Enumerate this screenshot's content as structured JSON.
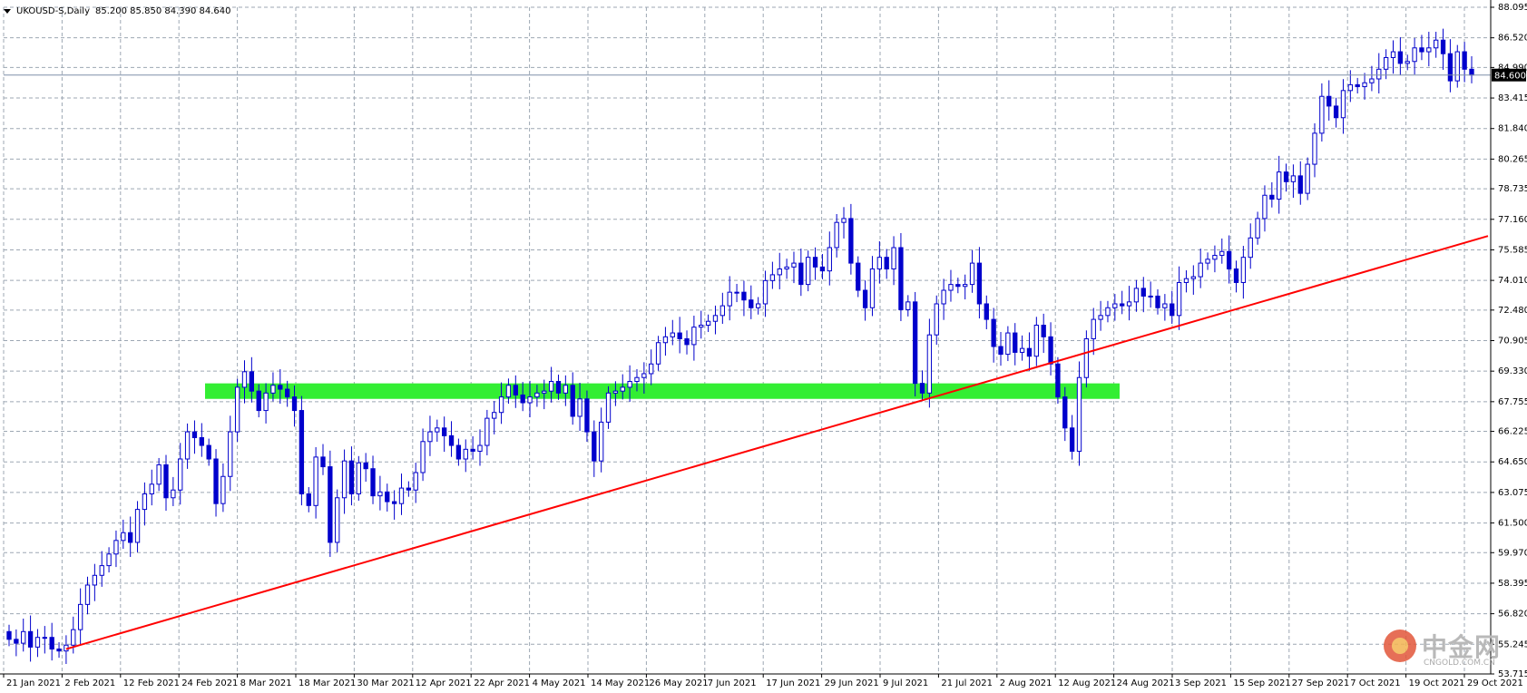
{
  "header": {
    "symbol": "UKOUSD-S,Daily",
    "ohlc": "85.200 85.850 84.390 84.640"
  },
  "watermark": {
    "brand": "中金网",
    "site": "CNGOLD.COM.CN"
  },
  "colors": {
    "bull_candle": "#ffffff",
    "bear_candle": "#0000cc",
    "candle_outline": "#0000cc",
    "trendline": "#ff0000",
    "support_zone": "#33ee33",
    "grid": "#9da7b3",
    "price_line": "#7f8fa8",
    "price_tag_bg": "#000000",
    "price_tag_fg": "#ffffff"
  },
  "chart_data": {
    "type": "candlestick",
    "y_ticks": [
      "88.095",
      "86.520",
      "84.990",
      "83.415",
      "81.840",
      "80.265",
      "78.735",
      "77.160",
      "75.585",
      "74.010",
      "72.480",
      "70.905",
      "69.330",
      "67.755",
      "66.225",
      "64.650",
      "63.075",
      "61.500",
      "59.970",
      "58.395",
      "56.820",
      "55.245",
      "53.715"
    ],
    "ylim": [
      53.715,
      88.095
    ],
    "x_ticks": [
      "21 Jan 2021",
      "2 Feb 2021",
      "12 Feb 2021",
      "24 Feb 2021",
      "8 Mar 2021",
      "18 Mar 2021",
      "30 Mar 2021",
      "12 Apr 2021",
      "22 Apr 2021",
      "4 May 2021",
      "14 May 2021",
      "26 May 2021",
      "7 Jun 2021",
      "17 Jun 2021",
      "29 Jun 2021",
      "9 Jul 2021",
      "21 Jul 2021",
      "2 Aug 2021",
      "12 Aug 2021",
      "24 Aug 2021",
      "3 Sep 2021",
      "15 Sep 2021",
      "27 Sep 2021",
      "7 Oct 2021",
      "19 Oct 2021",
      "29 Oct 2021"
    ],
    "closes": [
      55.5,
      55.3,
      55.9,
      55.1,
      55.6,
      55.6,
      55.0,
      54.9,
      55.2,
      56.0,
      57.3,
      58.3,
      58.8,
      59.3,
      59.9,
      60.6,
      61.0,
      60.5,
      62.2,
      63.0,
      63.5,
      64.5,
      62.8,
      63.2,
      64.8,
      66.2,
      65.9,
      65.5,
      64.8,
      62.5,
      63.9,
      66.2,
      68.5,
      69.3,
      68.3,
      67.3,
      68.2,
      68.6,
      68.4,
      68.0,
      67.3,
      63.0,
      62.4,
      64.9,
      64.4,
      60.5,
      62.8,
      64.7,
      63.0,
      64.6,
      64.3,
      62.9,
      63.1,
      62.6,
      62.5,
      63.3,
      63.2,
      64.1,
      65.7,
      66.2,
      66.4,
      66.0,
      65.5,
      64.8,
      65.3,
      65.2,
      65.5,
      66.9,
      67.2,
      68.0,
      68.6,
      68.1,
      67.7,
      68.0,
      68.2,
      68.3,
      68.8,
      68.2,
      68.6,
      67.0,
      67.9,
      66.2,
      64.7,
      66.7,
      68.2,
      68.3,
      68.5,
      68.8,
      69.0,
      69.2,
      69.7,
      70.8,
      71.1,
      71.3,
      71.0,
      70.7,
      71.6,
      71.7,
      71.9,
      72.2,
      72.7,
      73.4,
      73.4,
      73.0,
      72.6,
      72.8,
      74.0,
      74.3,
      74.6,
      74.7,
      74.9,
      73.8,
      75.2,
      74.7,
      74.5,
      75.7,
      77.0,
      77.2,
      74.9,
      73.5,
      72.6,
      74.6,
      75.2,
      74.6,
      75.7,
      72.5,
      72.9,
      68.7,
      68.2,
      71.2,
      72.8,
      73.5,
      73.8,
      73.7,
      73.8,
      74.9,
      72.8,
      72.0,
      70.6,
      70.2,
      71.3,
      70.3,
      70.5,
      70.1,
      71.7,
      71.1,
      69.7,
      68.0,
      66.4,
      65.2,
      69.0,
      71.0,
      72.0,
      72.2,
      72.6,
      72.8,
      72.7,
      72.9,
      73.6,
      73.2,
      73.2,
      72.6,
      72.8,
      72.2,
      73.9,
      74.1,
      74.2,
      74.9,
      75.1,
      75.3,
      75.5,
      74.6,
      73.9,
      75.2,
      76.2,
      77.2,
      78.4,
      78.2,
      79.6,
      79.1,
      79.4,
      78.5,
      80.0,
      81.6,
      83.5,
      83.0,
      82.4,
      83.8,
      84.1,
      84.0,
      84.2,
      84.4,
      84.9,
      85.5,
      85.8,
      85.2,
      85.3,
      86.0,
      85.8,
      86.0,
      86.4,
      85.7,
      84.3,
      85.8,
      84.9,
      84.6
    ]
  }
}
